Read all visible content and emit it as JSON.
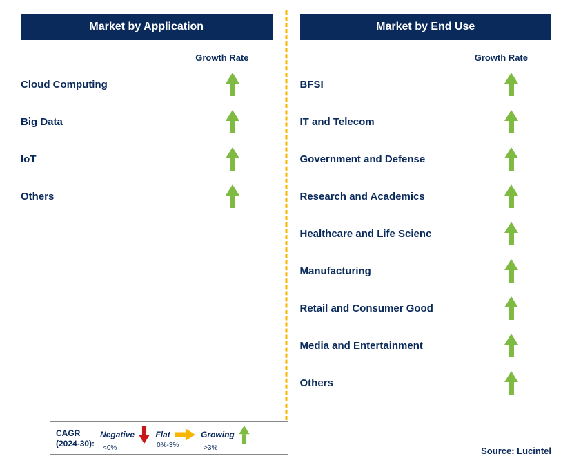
{
  "left": {
    "title": "Market by Application",
    "growth_label": "Growth Rate",
    "items": [
      {
        "label": "Cloud Computing",
        "growth": "growing"
      },
      {
        "label": "Big Data",
        "growth": "growing"
      },
      {
        "label": "IoT",
        "growth": "growing"
      },
      {
        "label": "Others",
        "growth": "growing"
      }
    ]
  },
  "right": {
    "title": "Market by End Use",
    "growth_label": "Growth Rate",
    "items": [
      {
        "label": "BFSI",
        "growth": "growing"
      },
      {
        "label": "IT and Telecom",
        "growth": "growing"
      },
      {
        "label": "Government and Defense",
        "growth": "growing"
      },
      {
        "label": "Research and Academics",
        "growth": "growing"
      },
      {
        "label": "Healthcare and Life Scienc",
        "growth": "growing"
      },
      {
        "label": "Manufacturing",
        "growth": "growing"
      },
      {
        "label": "Retail and Consumer Good",
        "growth": "growing"
      },
      {
        "label": "Media and Entertainment",
        "growth": "growing"
      },
      {
        "label": "Others",
        "growth": "growing"
      }
    ]
  },
  "legend": {
    "cagr_line1": "CAGR",
    "cagr_line2": "(2024-30):",
    "negative_label": "Negative",
    "negative_range": "<0%",
    "flat_label": "Flat",
    "flat_range": "0%-3%",
    "growing_label": "Growing",
    "growing_range": ">3%"
  },
  "source": "Source: Lucintel",
  "chart_data": {
    "type": "table",
    "title": "Market Growth Rate by Segment (CAGR 2024-30)",
    "legend_categories": {
      "negative": "<0%",
      "flat": "0%-3%",
      "growing": ">3%"
    },
    "panels": [
      {
        "name": "Market by Application",
        "series": [
          {
            "name": "Cloud Computing",
            "value": "growing"
          },
          {
            "name": "Big Data",
            "value": "growing"
          },
          {
            "name": "IoT",
            "value": "growing"
          },
          {
            "name": "Others",
            "value": "growing"
          }
        ]
      },
      {
        "name": "Market by End Use",
        "series": [
          {
            "name": "BFSI",
            "value": "growing"
          },
          {
            "name": "IT and Telecom",
            "value": "growing"
          },
          {
            "name": "Government and Defense",
            "value": "growing"
          },
          {
            "name": "Research and Academics",
            "value": "growing"
          },
          {
            "name": "Healthcare and Life Scienc",
            "value": "growing"
          },
          {
            "name": "Manufacturing",
            "value": "growing"
          },
          {
            "name": "Retail and Consumer Good",
            "value": "growing"
          },
          {
            "name": "Media and Entertainment",
            "value": "growing"
          },
          {
            "name": "Others",
            "value": "growing"
          }
        ]
      }
    ]
  }
}
